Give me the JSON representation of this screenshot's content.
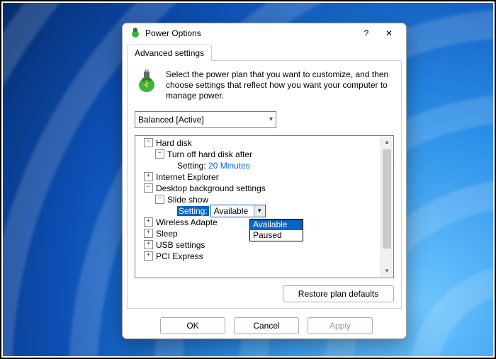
{
  "window": {
    "title": "Power Options",
    "help": "?",
    "close": "✕"
  },
  "tab": {
    "label": "Advanced settings"
  },
  "intro": "Select the power plan that you want to customize, and then choose settings that reflect how you want your computer to manage power.",
  "plan": {
    "selected": "Balanced [Active]"
  },
  "tree": {
    "hard_disk": "Hard disk",
    "turn_off": "Turn off hard disk after",
    "setting1_label": "Setting:",
    "setting1_value": "20 Minutes",
    "ie": "Internet Explorer",
    "desktop_bg": "Desktop background settings",
    "slideshow": "Slide show",
    "setting2_label": "Setting:",
    "setting2_value": "Available",
    "wireless": "Wireless Adapte",
    "sleep": "Sleep",
    "usb": "USB settings",
    "pci": "PCI Express"
  },
  "dropdown": {
    "opt1": "Available",
    "opt2": "Paused"
  },
  "buttons": {
    "restore": "Restore plan defaults",
    "ok": "OK",
    "cancel": "Cancel",
    "apply": "Apply"
  }
}
